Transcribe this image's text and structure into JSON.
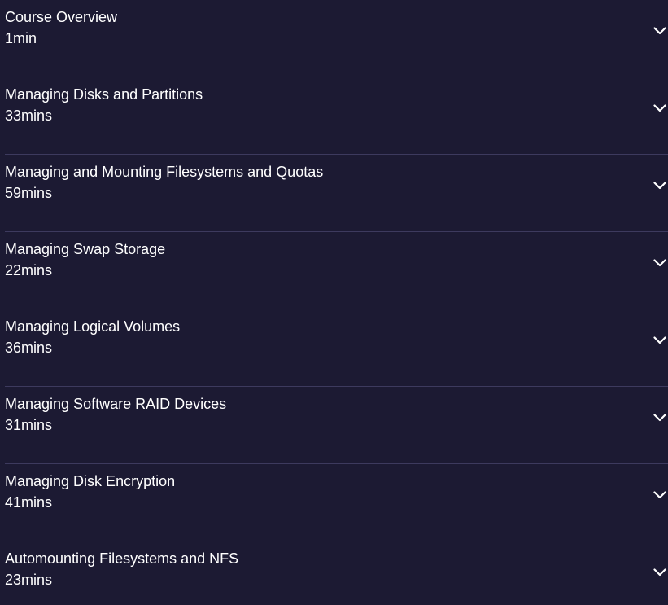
{
  "modules": [
    {
      "title": "Course Overview",
      "duration": "1min",
      "icon": "chevron-down-icon"
    },
    {
      "title": "Managing Disks and Partitions",
      "duration": "33mins",
      "icon": "chevron-down-icon"
    },
    {
      "title": "Managing and Mounting Filesystems and Quotas",
      "duration": "59mins",
      "icon": "chevron-down-icon"
    },
    {
      "title": "Managing Swap Storage",
      "duration": "22mins",
      "icon": "chevron-down-icon"
    },
    {
      "title": "Managing Logical Volumes",
      "duration": "36mins",
      "icon": "chevron-down-icon"
    },
    {
      "title": "Managing Software RAID Devices",
      "duration": "31mins",
      "icon": "chevron-down-icon"
    },
    {
      "title": "Managing Disk Encryption",
      "duration": "41mins",
      "icon": "chevron-down-icon"
    },
    {
      "title": "Automounting Filesystems and NFS",
      "duration": "23mins",
      "icon": "chevron-down-icon"
    }
  ],
  "colors": {
    "background": "#1c1a33",
    "divider": "#3d3a5e",
    "text": "#ffffff"
  }
}
